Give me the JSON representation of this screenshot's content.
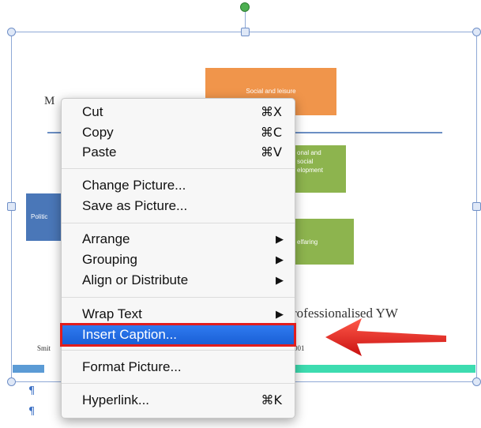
{
  "diagram": {
    "title_partial": "M",
    "orange_box": "Social and leisure",
    "green_box_1": [
      "onal and",
      "social",
      "elopment"
    ],
    "green_box_2": "elfaring",
    "blue_box": "Politic",
    "yw_text": "rofessionalised  YW",
    "smith": "Smit",
    "date_partial": "001",
    "paragraph_mark": "¶"
  },
  "context_menu": {
    "items": [
      {
        "label": "Cut",
        "shortcut": "⌘X"
      },
      {
        "label": "Copy",
        "shortcut": "⌘C"
      },
      {
        "label": "Paste",
        "shortcut": "⌘V"
      },
      {
        "label": "Change Picture..."
      },
      {
        "label": "Save as Picture..."
      },
      {
        "label": "Arrange",
        "arrow": "▶"
      },
      {
        "label": "Grouping",
        "arrow": "▶"
      },
      {
        "label": "Align or Distribute",
        "arrow": "▶"
      },
      {
        "label": "Wrap Text",
        "arrow": "▶"
      },
      {
        "label": "Insert Caption..."
      },
      {
        "label": "Format Picture..."
      },
      {
        "label": "Hyperlink...",
        "shortcut": "⌘K"
      }
    ],
    "highlighted": "Insert Caption...",
    "highlight_color": "#2f7bf0"
  },
  "annotation": {
    "callout_color": "#e21d1d"
  }
}
